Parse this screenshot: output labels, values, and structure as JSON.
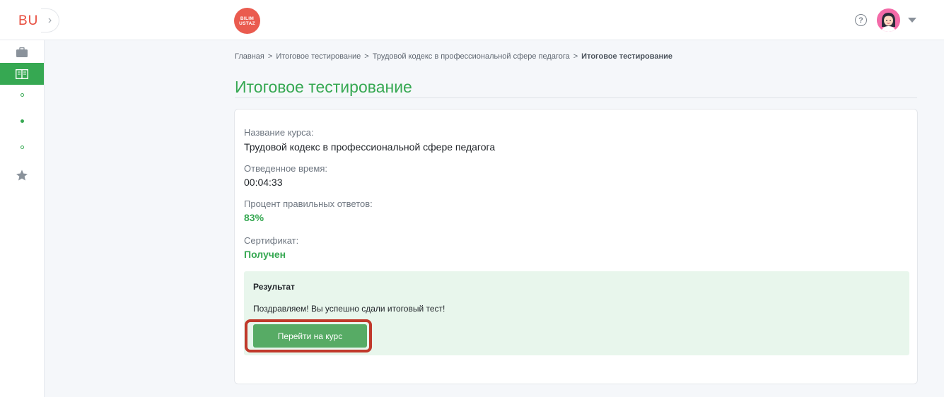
{
  "header": {
    "brand_short": "BU",
    "logo_line1": "BILIM",
    "logo_line2": "USTAZ",
    "help_glyph": "?",
    "colors": {
      "brand": "#e74b3c",
      "accent": "#36a852"
    }
  },
  "sidebar": {
    "icons": [
      "briefcase-icon",
      "book-icon",
      "dot-icon",
      "dot-icon",
      "dot-icon",
      "star-icon"
    ],
    "active_index": 1
  },
  "breadcrumb": {
    "items": [
      "Главная",
      "Итоговое тестирование",
      "Трудовой кодекс в профессиональной сфере педагога"
    ],
    "current": "Итоговое тестирование",
    "separator": ">"
  },
  "page": {
    "title": "Итоговое тестирование"
  },
  "details": {
    "course_label": "Название курса:",
    "course_value": "Трудовой кодекс в профессиональной сфере педагога",
    "time_label": "Отведенное время:",
    "time_value": "00:04:33",
    "percent_label": "Процент правильных ответов:",
    "percent_value": "83%",
    "certificate_label": "Сертификат:",
    "certificate_value": "Получен"
  },
  "result": {
    "title": "Результат",
    "message": "Поздравляем! Вы успешно сдали итоговый тест!",
    "button_label": "Перейти на курс"
  }
}
